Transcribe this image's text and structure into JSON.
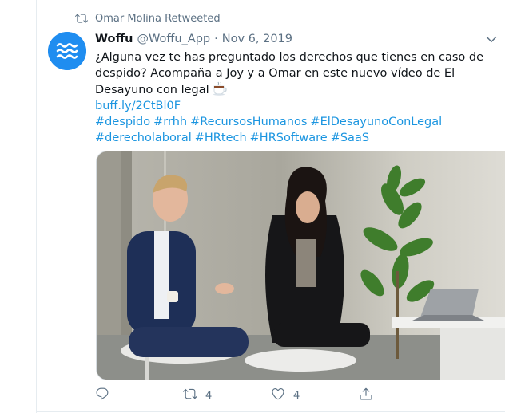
{
  "retweet": {
    "label": "Omar Molina Retweeted",
    "icon": "retweet-icon"
  },
  "author": {
    "name": "Woffu",
    "handle": "@Woffu_App",
    "separator": "·",
    "date": "Nov 6, 2019",
    "avatar_color": "#1f8df0"
  },
  "body": {
    "text": "¿Alguna vez te has preguntado los derechos que tienes en caso de despido? Acompaña a Joy y a Omar en este nuevo vídeo de El Desayuno con legal",
    "emoji": "coffee-icon",
    "link": "buff.ly/2CtBl0F",
    "hashtags": [
      "#despido",
      "#rrhh",
      "#RecursosHumanos",
      "#ElDesayunoConLegal",
      "#derecholaboral",
      "#HRtech",
      "#HRSoftware",
      "#SaaS"
    ]
  },
  "actions": {
    "reply_count": "",
    "retweet_count": "4",
    "like_count": "4"
  },
  "colors": {
    "link": "#1b95e0",
    "muted": "#5b7083",
    "text": "#0f1419"
  }
}
